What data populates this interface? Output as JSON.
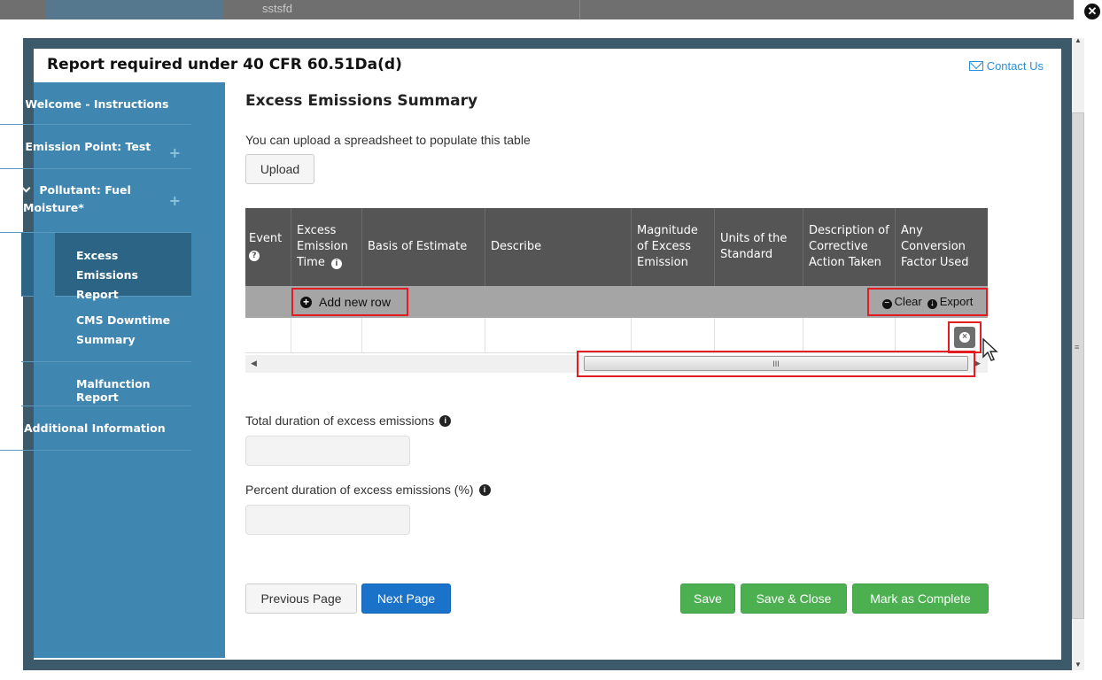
{
  "background": {
    "strip_text": "sstsfd"
  },
  "modal": {
    "title": "Report required under 40 CFR 60.51Da(d)",
    "contact_label": "Contact Us",
    "close_symbol": "✕"
  },
  "sidebar": {
    "items": [
      {
        "label": "Welcome - Instructions",
        "chevron": true
      },
      {
        "label": "Emission Point: Test",
        "chevron": true,
        "plus": "+"
      },
      {
        "label": "Pollutant: Fuel Moisture*",
        "chevron": true,
        "plus": "+"
      },
      {
        "label": "Excess Emissions Report",
        "active": true
      },
      {
        "label": "CMS Downtime Summary"
      },
      {
        "label": "Malfunction Report"
      },
      {
        "label": "Additional Information"
      }
    ]
  },
  "main": {
    "heading": "Excess Emissions Summary",
    "upload_text": "You can upload a spreadsheet to populate this table",
    "upload_button": "Upload",
    "table": {
      "columns": [
        {
          "label": "Event",
          "icon": "?"
        },
        {
          "label": "Excess Emission Time",
          "icon": "i"
        },
        {
          "label": "Basis of Estimate"
        },
        {
          "label": "Describe"
        },
        {
          "label": "Magnitude of Excess Emission"
        },
        {
          "label": "Units of the Standard"
        },
        {
          "label": "Description of Corrective Action Taken"
        },
        {
          "label": "Any Conversion Factor Used"
        }
      ],
      "add_row_label": "Add new row",
      "clear_label": "Clear",
      "export_label": "Export",
      "scroll_grip": "III"
    },
    "fields": {
      "total_duration_label": "Total duration of excess emissions",
      "total_duration_value": "",
      "percent_duration_label": "Percent duration of excess emissions (%)",
      "percent_duration_value": ""
    },
    "buttons": {
      "previous": "Previous Page",
      "next": "Next Page",
      "save": "Save",
      "save_close": "Save & Close",
      "mark_complete": "Mark as Complete"
    }
  },
  "colors": {
    "sidebar_bg": "#3f86b0",
    "sidebar_active": "#2c6486",
    "header_bg": "#555555",
    "primary": "#1a73c8",
    "success": "#4cb050",
    "highlight": "#e31b23"
  }
}
